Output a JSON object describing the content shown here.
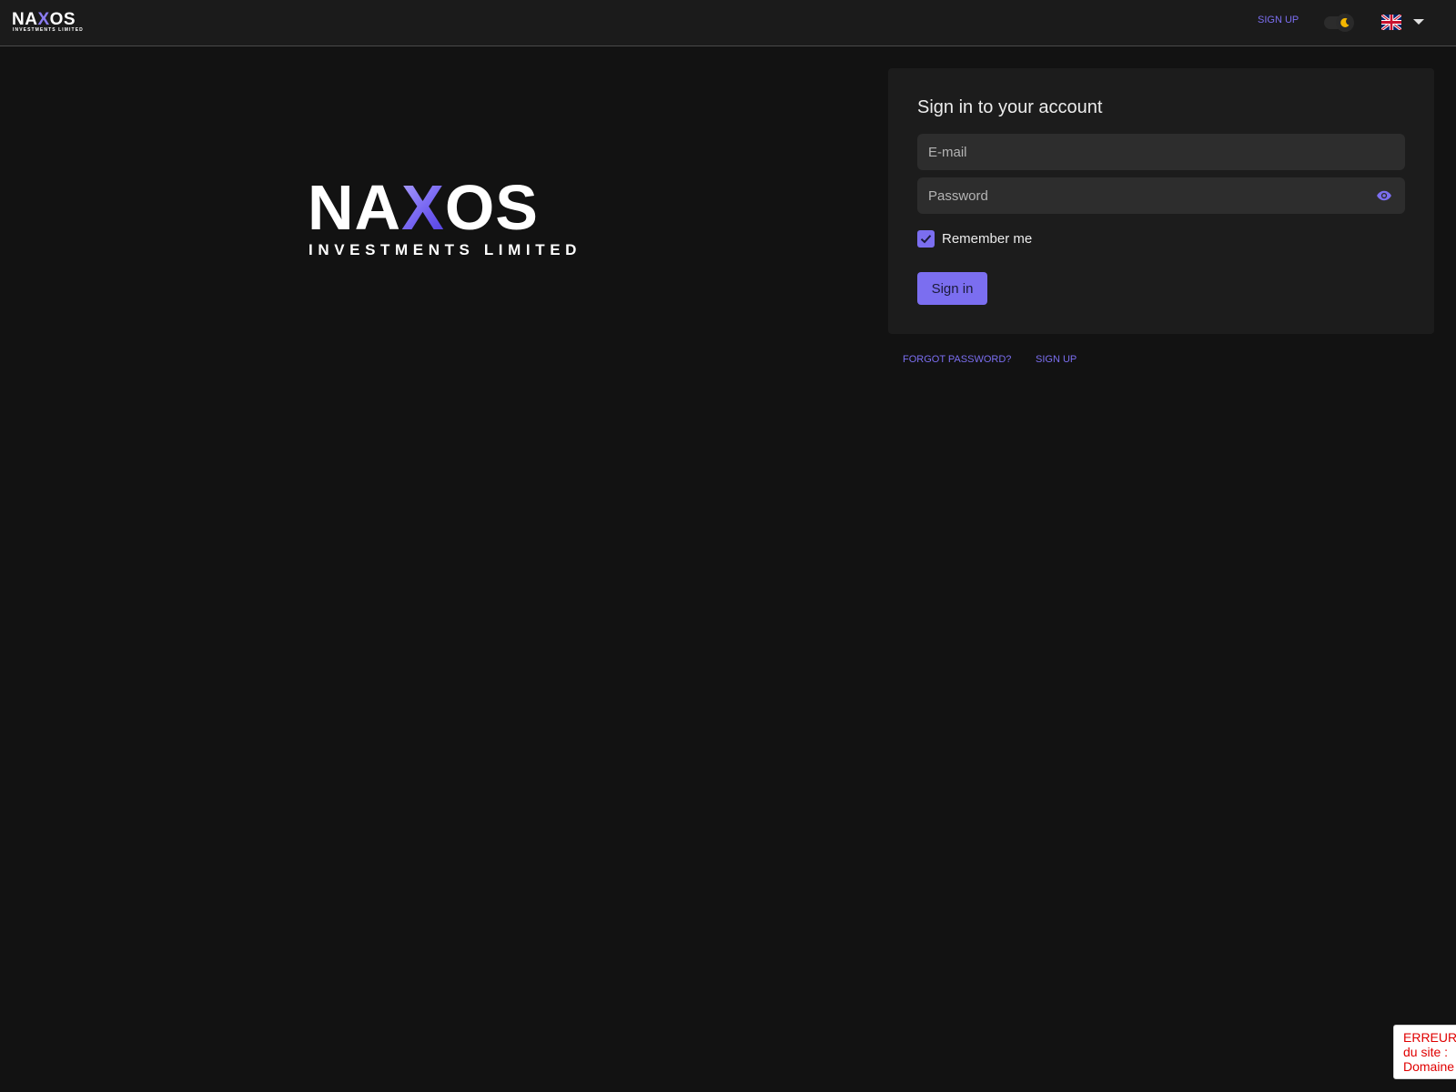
{
  "brand": {
    "name_prefix": "NA",
    "name_x": "X",
    "name_suffix": "OS",
    "tagline": "INVESTMENTS LIMITED"
  },
  "navbar": {
    "signup_label": "SIGN UP",
    "theme_toggle_icon": "moon-icon",
    "language_flag_icon": "uk-flag-icon",
    "language_caret_icon": "caret-down-icon"
  },
  "login": {
    "title": "Sign in to your account",
    "email_placeholder": "E-mail",
    "email_value": "",
    "password_placeholder": "Password",
    "password_value": "",
    "password_toggle_icon": "eye-icon",
    "remember_label": "Remember me",
    "remember_checked": true,
    "submit_label": "Sign in"
  },
  "links": {
    "forgot_password": "FORGOT PASSWORD?",
    "signup": "SIGN UP"
  },
  "error_box": {
    "line1": "ERREUR p",
    "line2": "du site :",
    "line3": "Domaine"
  },
  "colors": {
    "background": "#121212",
    "navbar": "#1b1b1b",
    "card": "#1c1c1c",
    "input": "#2d2d2d",
    "accent": "#7b6ef0",
    "error": "#e00000"
  }
}
